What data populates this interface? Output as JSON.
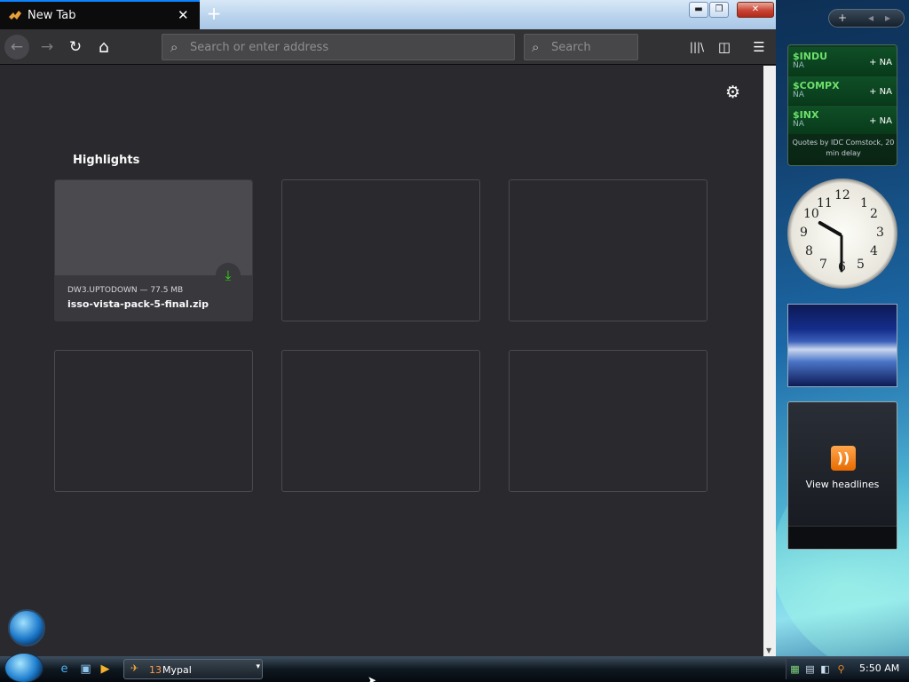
{
  "browser": {
    "tab_title": "New Tab",
    "tab_close": "✕",
    "new_tab": "+",
    "window_buttons": {
      "minimize": "▬",
      "restore": "❐",
      "close": "✕"
    },
    "nav": {
      "back": "←",
      "forward": "→",
      "reload": "↻",
      "home": "⌂"
    },
    "url_placeholder": "Search or enter address",
    "search_placeholder": "Search",
    "toolbar": {
      "library": "|||\\",
      "sidebar": "◫",
      "menu": "☰"
    },
    "settings_icon": "⚙",
    "highlights_title": "Highlights",
    "highlights": [
      {
        "host": "DW3.UPTODOWN — 77.5 MB",
        "filename": "isso-vista-pack-5-final.zip",
        "download_icon": "⤓"
      }
    ]
  },
  "gadgets": {
    "sidebar_add": "+",
    "sidebar_prev": "◂",
    "sidebar_next": "▸",
    "stocks": [
      {
        "symbol": "$INDU",
        "value": "NA",
        "change": "+ NA"
      },
      {
        "symbol": "$COMPX",
        "value": "NA",
        "change": "+ NA"
      },
      {
        "symbol": "$INX",
        "value": "NA",
        "change": "+ NA"
      }
    ],
    "stocks_source": "Quotes by IDC Comstock, 20 min delay",
    "clock_numbers": [
      "12",
      "1",
      "2",
      "3",
      "4",
      "5",
      "6",
      "7",
      "8",
      "9",
      "10",
      "11"
    ],
    "feed_label": "View headlines",
    "feed_icon": "))"
  },
  "taskbar": {
    "task_count": "13",
    "task_label": "Mypal",
    "task_dropdown": "▾",
    "time": "5:50 AM"
  }
}
